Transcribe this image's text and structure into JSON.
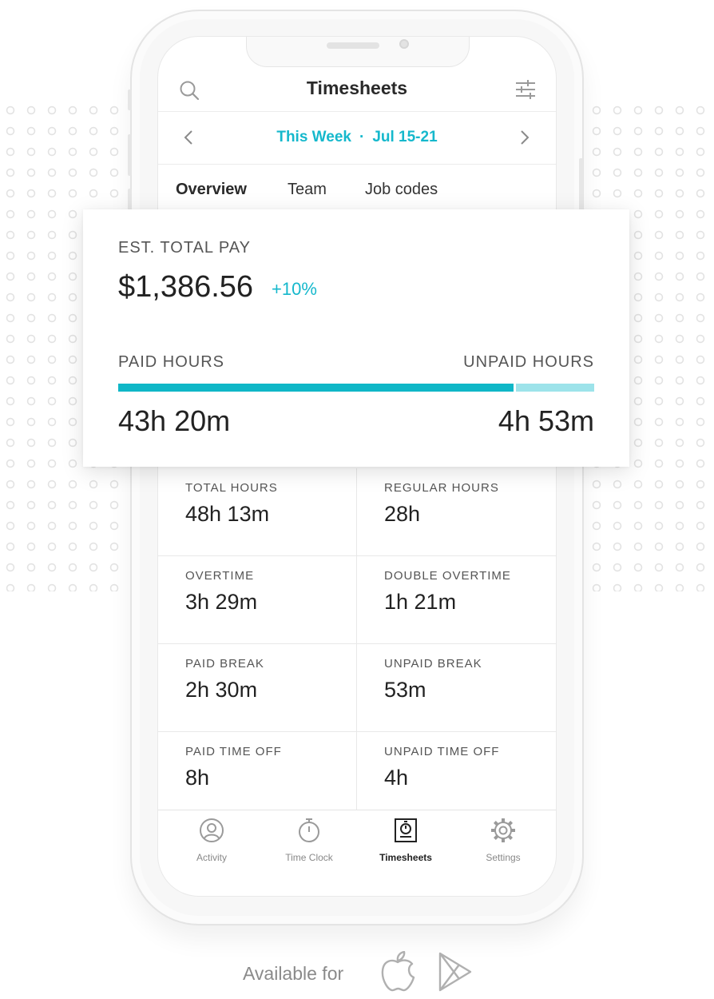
{
  "header": {
    "title": "Timesheets",
    "icons": {
      "search": "search-icon",
      "filter": "sliders-icon"
    }
  },
  "period": {
    "label": "This Week",
    "separator": "·",
    "range": "Jul 15-21",
    "icons": {
      "previous": "chevron-left-icon",
      "next": "chevron-right-icon"
    }
  },
  "tabs": [
    {
      "label": "Overview",
      "active": true
    },
    {
      "label": "Team",
      "active": false
    },
    {
      "label": "Job codes",
      "active": false
    }
  ],
  "summary": {
    "est_label": "EST. TOTAL PAY",
    "amount": "$1,386.56",
    "change": "+10%",
    "paid_label": "PAID HOURS",
    "unpaid_label": "UNPAID HOURS",
    "paid_value": "43h 20m",
    "unpaid_value": "4h 53m",
    "paid_fraction": 0.83
  },
  "stats": [
    {
      "label": "TOTAL HOURS",
      "value": "48h 13m"
    },
    {
      "label": "REGULAR HOURS",
      "value": "28h"
    },
    {
      "label": "OVERTIME",
      "value": "3h 29m"
    },
    {
      "label": "DOUBLE OVERTIME",
      "value": "1h 21m"
    },
    {
      "label": "PAID BREAK",
      "value": "2h 30m"
    },
    {
      "label": "UNPAID BREAK",
      "value": "53m"
    },
    {
      "label": "PAID TIME OFF",
      "value": "8h"
    },
    {
      "label": "UNPAID TIME OFF",
      "value": "4h"
    }
  ],
  "tabbar": [
    {
      "label": "Activity",
      "icon": "user-circle-icon",
      "active": false
    },
    {
      "label": "Time Clock",
      "icon": "stopwatch-icon",
      "active": false
    },
    {
      "label": "Timesheets",
      "icon": "timesheet-icon",
      "active": true
    },
    {
      "label": "Settings",
      "icon": "gear-icon",
      "active": false
    }
  ],
  "availability": {
    "text": "Available for",
    "icons": [
      "apple-icon",
      "google-play-icon"
    ]
  },
  "colors": {
    "accent": "#15b8cc",
    "bar_paid": "#0fb7c7",
    "bar_unpaid": "#9de3ea"
  }
}
